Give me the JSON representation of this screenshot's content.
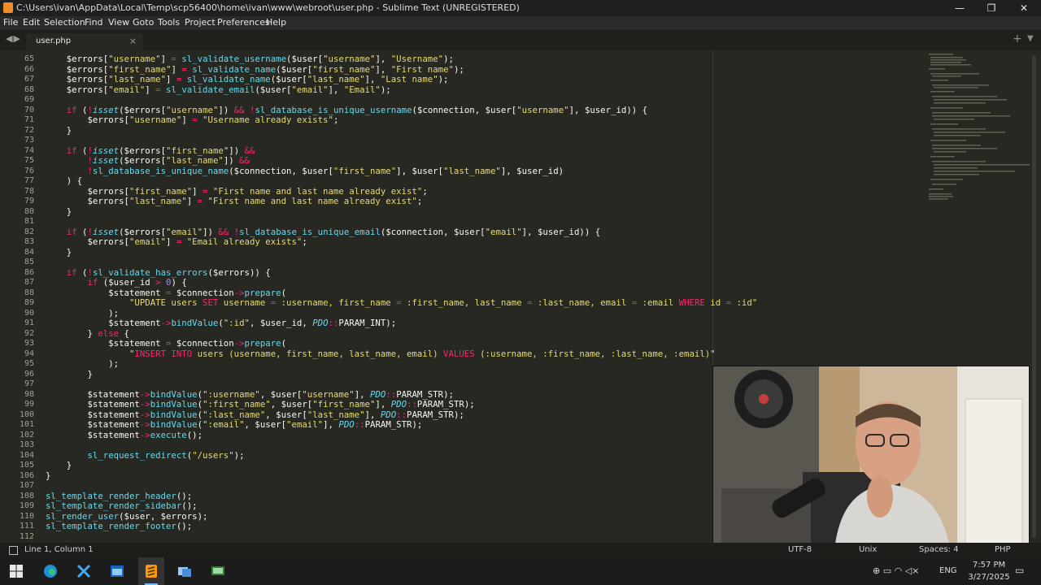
{
  "window": {
    "title": "C:\\Users\\ivan\\AppData\\Local\\Temp\\scp56400\\home\\ivan\\www\\webroot\\user.php - Sublime Text (UNREGISTERED)",
    "controls": {
      "minimize": "—",
      "maximize": "❐",
      "close": "✕"
    }
  },
  "menu": [
    "File",
    "Edit",
    "Selection",
    "Find",
    "View",
    "Goto",
    "Tools",
    "Project",
    "Preferences",
    "Help"
  ],
  "tab": {
    "label": "user.php",
    "close": "×"
  },
  "tab_nav": {
    "prev": "◀",
    "next": "▶",
    "new": "+",
    "dropdown": "▼"
  },
  "editor": {
    "line_numbers": [
      "65",
      "66",
      "67",
      "68",
      "69",
      "70",
      "71",
      "72",
      "73",
      "74",
      "75",
      "76",
      "77",
      "78",
      "79",
      "80",
      "81",
      "82",
      "83",
      "84",
      "85",
      "86",
      "87",
      "88",
      "89",
      "90",
      "91",
      "92",
      "93",
      "94",
      "95",
      "96",
      "97",
      "98",
      "99",
      "100",
      "101",
      "102",
      "103",
      "104",
      "105",
      "106",
      "107",
      "108",
      "109",
      "110",
      "111",
      "112"
    ],
    "lines": [
      [
        [
          "v",
          "    $errors["
        ],
        [
          "s",
          "\"username\""
        ],
        [
          "v",
          "] "
        ],
        [
          "k",
          "="
        ],
        [
          "v",
          " "
        ],
        [
          "f",
          "sl_validate_username"
        ],
        [
          "v",
          "($user["
        ],
        [
          "s",
          "\"username\""
        ],
        [
          "v",
          "], "
        ],
        [
          "s",
          "\"Username\""
        ],
        [
          "v",
          ");"
        ]
      ],
      [
        [
          "v",
          "    $errors["
        ],
        [
          "s",
          "\"first_name\""
        ],
        [
          "v",
          "] "
        ],
        [
          "k",
          "="
        ],
        [
          "v",
          " "
        ],
        [
          "f",
          "sl_validate_name"
        ],
        [
          "v",
          "($user["
        ],
        [
          "s",
          "\"first_name\""
        ],
        [
          "v",
          "], "
        ],
        [
          "s",
          "\"First name\""
        ],
        [
          "v",
          ");"
        ]
      ],
      [
        [
          "v",
          "    $errors["
        ],
        [
          "s",
          "\"last_name\""
        ],
        [
          "v",
          "] "
        ],
        [
          "k",
          "="
        ],
        [
          "v",
          " "
        ],
        [
          "f",
          "sl_validate_name"
        ],
        [
          "v",
          "($user["
        ],
        [
          "s",
          "\"last_name\""
        ],
        [
          "v",
          "], "
        ],
        [
          "s",
          "\"Last name\""
        ],
        [
          "v",
          ");"
        ]
      ],
      [
        [
          "v",
          "    $errors["
        ],
        [
          "s",
          "\"email\""
        ],
        [
          "v",
          "] "
        ],
        [
          "k",
          "="
        ],
        [
          "v",
          " "
        ],
        [
          "f",
          "sl_validate_email"
        ],
        [
          "v",
          "($user["
        ],
        [
          "s",
          "\"email\""
        ],
        [
          "v",
          "], "
        ],
        [
          "s",
          "\"Email\""
        ],
        [
          "v",
          ");"
        ]
      ],
      [],
      [
        [
          "v",
          "    "
        ],
        [
          "kw",
          "if"
        ],
        [
          "v",
          " ("
        ],
        [
          "k",
          "!"
        ],
        [
          "c",
          "isset"
        ],
        [
          "v",
          "($errors["
        ],
        [
          "s",
          "\"username\""
        ],
        [
          "v",
          "]) "
        ],
        [
          "k",
          "&&"
        ],
        [
          "v",
          " "
        ],
        [
          "k",
          "!"
        ],
        [
          "f",
          "sl_database_is_unique_username"
        ],
        [
          "v",
          "($connection, $user["
        ],
        [
          "s",
          "\"username\""
        ],
        [
          "v",
          "], $user_id)) {"
        ]
      ],
      [
        [
          "v",
          "        $errors["
        ],
        [
          "s",
          "\"username\""
        ],
        [
          "v",
          "] "
        ],
        [
          "k",
          "="
        ],
        [
          "v",
          " "
        ],
        [
          "s",
          "\"Username already exists\""
        ],
        [
          "v",
          ";"
        ]
      ],
      [
        [
          "v",
          "    }"
        ]
      ],
      [],
      [
        [
          "v",
          "    "
        ],
        [
          "kw",
          "if"
        ],
        [
          "v",
          " ("
        ],
        [
          "k",
          "!"
        ],
        [
          "c",
          "isset"
        ],
        [
          "v",
          "($errors["
        ],
        [
          "s",
          "\"first_name\""
        ],
        [
          "v",
          "]) "
        ],
        [
          "k",
          "&&"
        ]
      ],
      [
        [
          "v",
          "        "
        ],
        [
          "k",
          "!"
        ],
        [
          "c",
          "isset"
        ],
        [
          "v",
          "($errors["
        ],
        [
          "s",
          "\"last_name\""
        ],
        [
          "v",
          "]) "
        ],
        [
          "k",
          "&&"
        ]
      ],
      [
        [
          "v",
          "        "
        ],
        [
          "k",
          "!"
        ],
        [
          "f",
          "sl_database_is_unique_name"
        ],
        [
          "v",
          "($connection, $user["
        ],
        [
          "s",
          "\"first_name\""
        ],
        [
          "v",
          "], $user["
        ],
        [
          "s",
          "\"last_name\""
        ],
        [
          "v",
          "], $user_id)"
        ]
      ],
      [
        [
          "v",
          "    ) {"
        ]
      ],
      [
        [
          "v",
          "        $errors["
        ],
        [
          "s",
          "\"first_name\""
        ],
        [
          "v",
          "] "
        ],
        [
          "k",
          "="
        ],
        [
          "v",
          " "
        ],
        [
          "s",
          "\"First name and last name already exist\""
        ],
        [
          "v",
          ";"
        ]
      ],
      [
        [
          "v",
          "        $errors["
        ],
        [
          "s",
          "\"last_name\""
        ],
        [
          "v",
          "] "
        ],
        [
          "k",
          "="
        ],
        [
          "v",
          " "
        ],
        [
          "s",
          "\"First name and last name already exist\""
        ],
        [
          "v",
          ";"
        ]
      ],
      [
        [
          "v",
          "    }"
        ]
      ],
      [],
      [
        [
          "v",
          "    "
        ],
        [
          "kw",
          "if"
        ],
        [
          "v",
          " ("
        ],
        [
          "k",
          "!"
        ],
        [
          "c",
          "isset"
        ],
        [
          "v",
          "($errors["
        ],
        [
          "s",
          "\"email\""
        ],
        [
          "v",
          "]) "
        ],
        [
          "k",
          "&&"
        ],
        [
          "v",
          " "
        ],
        [
          "k",
          "!"
        ],
        [
          "f",
          "sl_database_is_unique_email"
        ],
        [
          "v",
          "($connection, $user["
        ],
        [
          "s",
          "\"email\""
        ],
        [
          "v",
          "], $user_id)) {"
        ]
      ],
      [
        [
          "v",
          "        $errors["
        ],
        [
          "s",
          "\"email\""
        ],
        [
          "v",
          "] "
        ],
        [
          "k",
          "="
        ],
        [
          "v",
          " "
        ],
        [
          "s",
          "\"Email already exists\""
        ],
        [
          "v",
          ";"
        ]
      ],
      [
        [
          "v",
          "    }"
        ]
      ],
      [],
      [
        [
          "v",
          "    "
        ],
        [
          "kw",
          "if"
        ],
        [
          "v",
          " ("
        ],
        [
          "k",
          "!"
        ],
        [
          "f",
          "sl_validate_has_errors"
        ],
        [
          "v",
          "($errors)) {"
        ]
      ],
      [
        [
          "v",
          "        "
        ],
        [
          "kw",
          "if"
        ],
        [
          "v",
          " ($user_id "
        ],
        [
          "k",
          ">"
        ],
        [
          "v",
          " "
        ],
        [
          "n",
          "0"
        ],
        [
          "v",
          ") {"
        ]
      ],
      [
        [
          "v",
          "            $statement "
        ],
        [
          "k",
          "="
        ],
        [
          "v",
          " $connection"
        ],
        [
          "k",
          "->"
        ],
        [
          "f",
          "prepare"
        ],
        [
          "v",
          "("
        ]
      ],
      [
        [
          "v",
          "                "
        ],
        [
          "s",
          "\"UPDATE users "
        ],
        [
          "kw",
          "SET"
        ],
        [
          "s",
          " username "
        ],
        [
          "k",
          "="
        ],
        [
          "s",
          " :username, first_name "
        ],
        [
          "k",
          "="
        ],
        [
          "s",
          " :first_name, last_name "
        ],
        [
          "k",
          "="
        ],
        [
          "s",
          " :last_name, email "
        ],
        [
          "k",
          "="
        ],
        [
          "s",
          " :email "
        ],
        [
          "kw",
          "WHERE"
        ],
        [
          "s",
          " id "
        ],
        [
          "k",
          "="
        ],
        [
          "s",
          " :id\""
        ]
      ],
      [
        [
          "v",
          "            );"
        ]
      ],
      [
        [
          "v",
          "            $statement"
        ],
        [
          "k",
          "->"
        ],
        [
          "f",
          "bindValue"
        ],
        [
          "v",
          "("
        ],
        [
          "s",
          "\":id\""
        ],
        [
          "v",
          ", $user_id, "
        ],
        [
          "c",
          "PDO"
        ],
        [
          "k",
          "::"
        ],
        [
          "v",
          "PARAM_INT);"
        ]
      ],
      [
        [
          "v",
          "        } "
        ],
        [
          "kw",
          "else"
        ],
        [
          "v",
          " {"
        ]
      ],
      [
        [
          "v",
          "            $statement "
        ],
        [
          "k",
          "="
        ],
        [
          "v",
          " $connection"
        ],
        [
          "k",
          "->"
        ],
        [
          "f",
          "prepare"
        ],
        [
          "v",
          "("
        ]
      ],
      [
        [
          "v",
          "                "
        ],
        [
          "s",
          "\""
        ],
        [
          "kw",
          "INSERT INTO"
        ],
        [
          "s",
          " users (username, first_name, last_name, email) "
        ],
        [
          "kw",
          "VALUES"
        ],
        [
          "s",
          " (:username, :first_name, :last_name, :email)\""
        ]
      ],
      [
        [
          "v",
          "            );"
        ]
      ],
      [
        [
          "v",
          "        }"
        ]
      ],
      [],
      [
        [
          "v",
          "        $statement"
        ],
        [
          "k",
          "->"
        ],
        [
          "f",
          "bindValue"
        ],
        [
          "v",
          "("
        ],
        [
          "s",
          "\":username\""
        ],
        [
          "v",
          ", $user["
        ],
        [
          "s",
          "\"username\""
        ],
        [
          "v",
          "], "
        ],
        [
          "c",
          "PDO"
        ],
        [
          "k",
          "::"
        ],
        [
          "v",
          "PARAM_STR);"
        ]
      ],
      [
        [
          "v",
          "        $statement"
        ],
        [
          "k",
          "->"
        ],
        [
          "f",
          "bindValue"
        ],
        [
          "v",
          "("
        ],
        [
          "s",
          "\":first_name\""
        ],
        [
          "v",
          ", $user["
        ],
        [
          "s",
          "\"first_name\""
        ],
        [
          "v",
          "], "
        ],
        [
          "c",
          "PDO"
        ],
        [
          "k",
          "::"
        ],
        [
          "v",
          "PARAM_STR);"
        ]
      ],
      [
        [
          "v",
          "        $statement"
        ],
        [
          "k",
          "->"
        ],
        [
          "f",
          "bindValue"
        ],
        [
          "v",
          "("
        ],
        [
          "s",
          "\":last_name\""
        ],
        [
          "v",
          ", $user["
        ],
        [
          "s",
          "\"last_name\""
        ],
        [
          "v",
          "], "
        ],
        [
          "c",
          "PDO"
        ],
        [
          "k",
          "::"
        ],
        [
          "v",
          "PARAM_STR);"
        ]
      ],
      [
        [
          "v",
          "        $statement"
        ],
        [
          "k",
          "->"
        ],
        [
          "f",
          "bindValue"
        ],
        [
          "v",
          "("
        ],
        [
          "s",
          "\":email\""
        ],
        [
          "v",
          ", $user["
        ],
        [
          "s",
          "\"email\""
        ],
        [
          "v",
          "], "
        ],
        [
          "c",
          "PDO"
        ],
        [
          "k",
          "::"
        ],
        [
          "v",
          "PARAM_STR);"
        ]
      ],
      [
        [
          "v",
          "        $statement"
        ],
        [
          "k",
          "->"
        ],
        [
          "f",
          "execute"
        ],
        [
          "v",
          "();"
        ]
      ],
      [],
      [
        [
          "v",
          "        "
        ],
        [
          "f",
          "sl_request_redirect"
        ],
        [
          "v",
          "("
        ],
        [
          "s",
          "\"/users\""
        ],
        [
          "v",
          ");"
        ]
      ],
      [
        [
          "v",
          "    }"
        ]
      ],
      [
        [
          "v",
          "}"
        ]
      ],
      [],
      [
        [
          "f",
          "sl_template_render_header"
        ],
        [
          "v",
          "();"
        ]
      ],
      [
        [
          "f",
          "sl_template_render_sidebar"
        ],
        [
          "v",
          "();"
        ]
      ],
      [
        [
          "f",
          "sl_render_user"
        ],
        [
          "v",
          "($user, $errors);"
        ]
      ],
      [
        [
          "f",
          "sl_template_render_footer"
        ],
        [
          "v",
          "();"
        ]
      ],
      []
    ]
  },
  "status": {
    "position": "Line 1, Column 1",
    "encoding": "UTF-8",
    "line_endings": "Unix",
    "indent": "Spaces: 4",
    "syntax": "PHP"
  },
  "taskbar": {
    "language": "ENG",
    "time": "7:57 PM",
    "date": "3/27/2025"
  },
  "colors": {
    "bg": "#272822",
    "string": "#e6db74",
    "function": "#66d9ef",
    "keyword": "#f92672",
    "number": "#ae81ff"
  }
}
